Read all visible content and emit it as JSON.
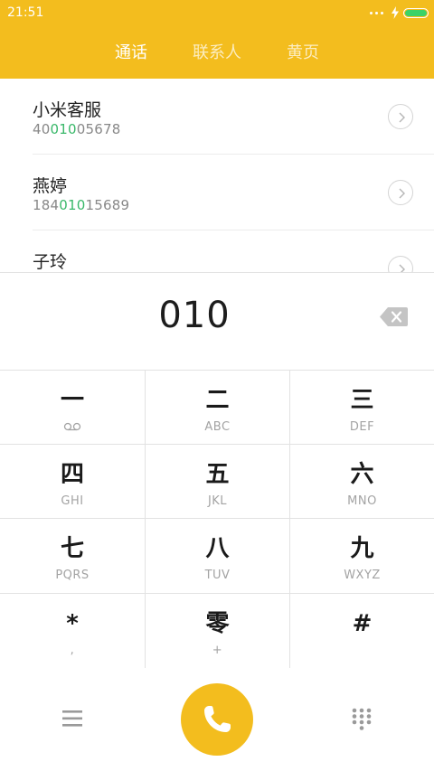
{
  "status_bar": {
    "time": "21:51",
    "battery_level": 1.0,
    "battery_color": "#3ad267"
  },
  "colors": {
    "accent": "#f3bd1e",
    "match_highlight": "#3ab86a"
  },
  "tabs": [
    {
      "label": "通话",
      "active": true
    },
    {
      "label": "联系人",
      "active": false
    },
    {
      "label": "黄页",
      "active": false
    }
  ],
  "results": [
    {
      "name": "小米客服",
      "number_prefix": "40",
      "number_match": "010",
      "number_suffix": "05678"
    },
    {
      "name": "燕婷",
      "number_prefix": "184",
      "number_match": "010",
      "number_suffix": "15689"
    },
    {
      "name": "子玲",
      "number_prefix": "",
      "number_match": "",
      "number_suffix": ""
    }
  ],
  "dial_input": {
    "value": "010"
  },
  "keypad": [
    {
      "main": "一",
      "sub": "",
      "sub_icon": "voicemail-icon"
    },
    {
      "main": "二",
      "sub": "ABC"
    },
    {
      "main": "三",
      "sub": "DEF"
    },
    {
      "main": "四",
      "sub": "GHI"
    },
    {
      "main": "五",
      "sub": "JKL"
    },
    {
      "main": "六",
      "sub": "MNO"
    },
    {
      "main": "七",
      "sub": "PQRS"
    },
    {
      "main": "八",
      "sub": "TUV"
    },
    {
      "main": "九",
      "sub": "WXYZ"
    },
    {
      "main": "*",
      "sub": ","
    },
    {
      "main": "零",
      "sub": "+"
    },
    {
      "main": "#",
      "sub": ""
    }
  ],
  "bottom_bar": {
    "left_icon": "menu-icon",
    "center_icon": "phone-icon",
    "right_icon": "dialpad-icon"
  }
}
